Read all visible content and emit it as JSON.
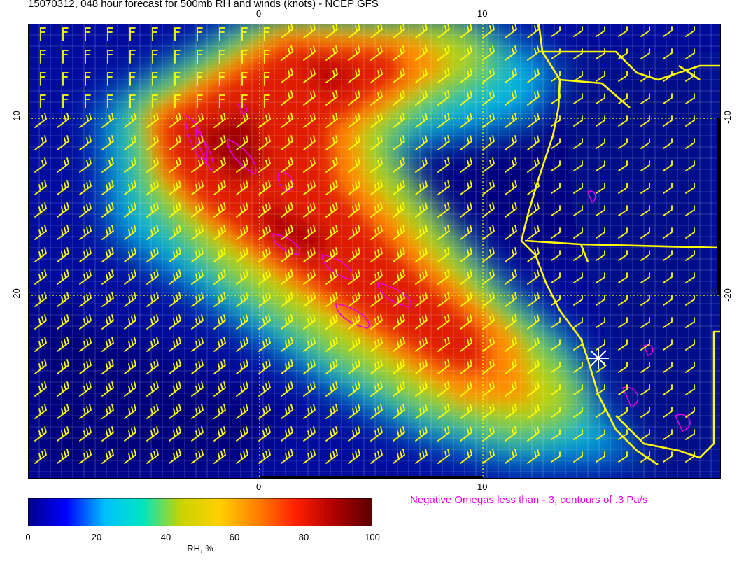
{
  "title": "15070312, 048 hour forecast for 500mb RH and winds (knots) - NCEP GFS",
  "axes": {
    "top_ticks": [
      "0",
      "10"
    ],
    "bottom_ticks": [
      "0",
      "10"
    ],
    "left_ticks": [
      "-10",
      "-20"
    ],
    "right_ticks": [
      "-10",
      "-20"
    ]
  },
  "colorbar": {
    "ticks": [
      "0",
      "20",
      "40",
      "60",
      "80",
      "100"
    ],
    "label": "RH, %",
    "colors": [
      "#00008b",
      "#0000ff",
      "#00bfff",
      "#00e5c0",
      "#c8d400",
      "#ffd000",
      "#ff8000",
      "#ff2000",
      "#b00000",
      "#5a0000"
    ]
  },
  "omega_note": "Negative Omegas less than -.3, contours of .3 Pa/s",
  "overlay_colors": {
    "barbs": "#ffff00",
    "coast": "#ffff00",
    "omega": "#e600e6",
    "grid": "#ffffff"
  }
}
